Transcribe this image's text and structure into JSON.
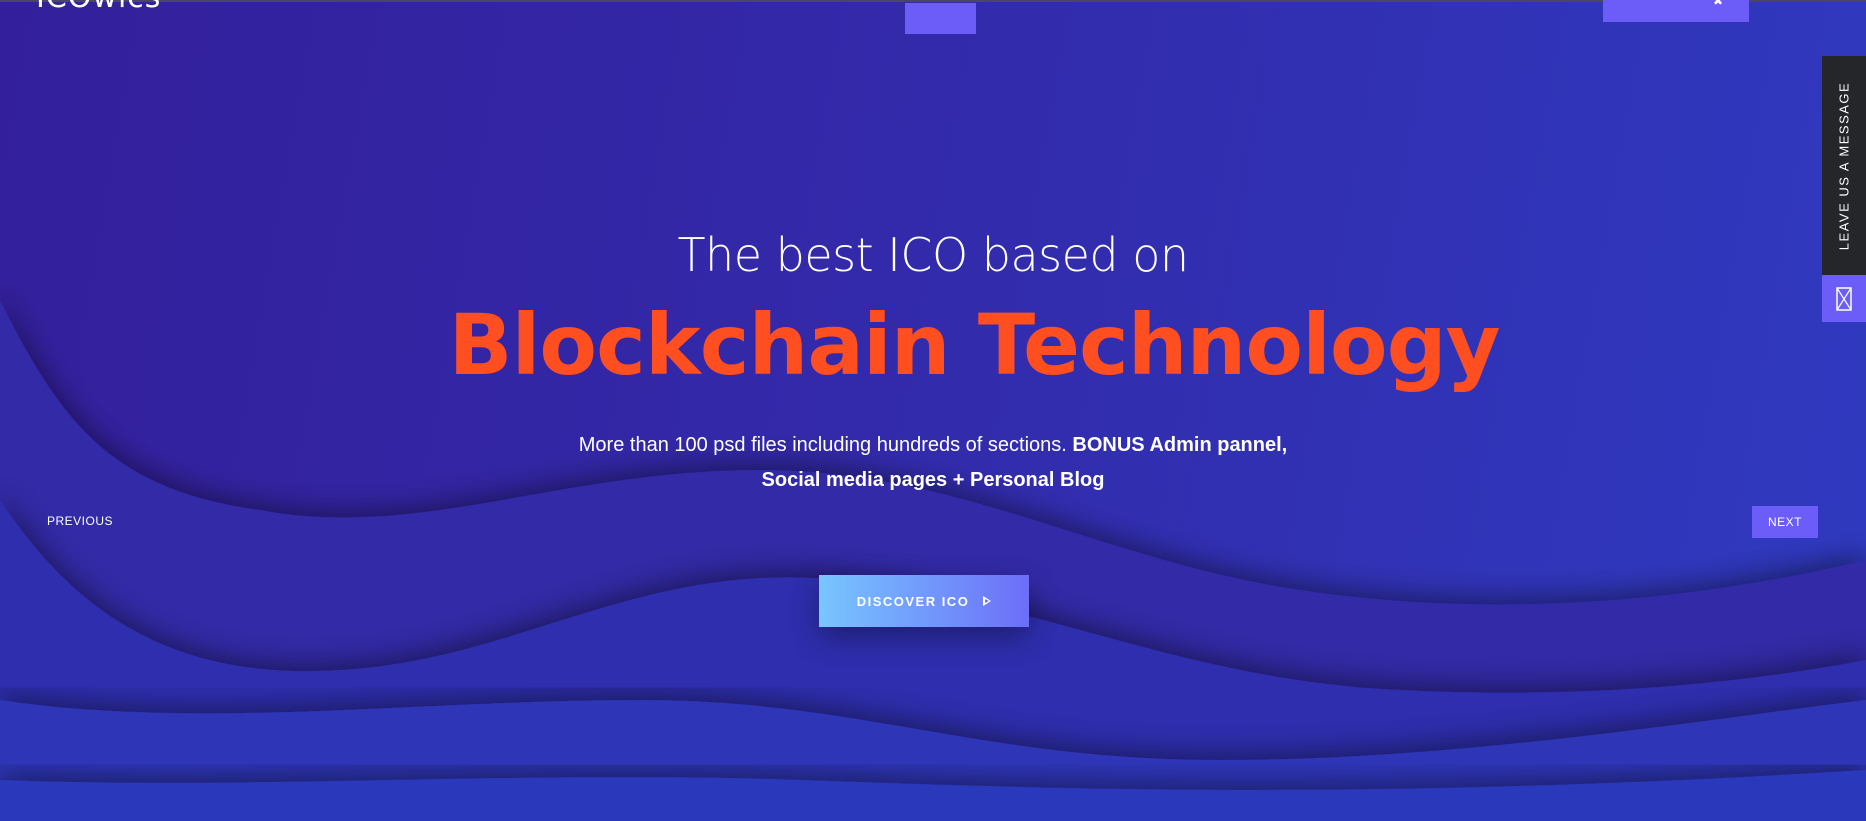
{
  "header": {
    "logo_text": "ICOwlcs",
    "cta_icon": "user-icon"
  },
  "hero": {
    "line1": "The best ICO based on",
    "line2": "Blockchain Technology",
    "subtitle_plain": "More than 100 psd files including hundreds of sections. ",
    "subtitle_bold_1": "BONUS Admin pannel,",
    "subtitle_bold_2": "Social media pages + Personal Blog",
    "cta_label": "DISCOVER ICO",
    "cta_icon": "play-icon"
  },
  "slider": {
    "previous_label": "PREVIOUS",
    "next_label": "NEXT"
  },
  "side_tab": {
    "label": "LEAVE US A MESSAGE",
    "icon": "mail-icon"
  },
  "colors": {
    "background_start": "#331f9b",
    "background_end": "#2f3ac0",
    "accent_orange": "#ff4e1f",
    "accent_purple": "#6c5cf8",
    "button_gradient_start": "#78c6ff",
    "button_gradient_end": "#6c6ef8",
    "side_tab_dark": "#252629"
  }
}
